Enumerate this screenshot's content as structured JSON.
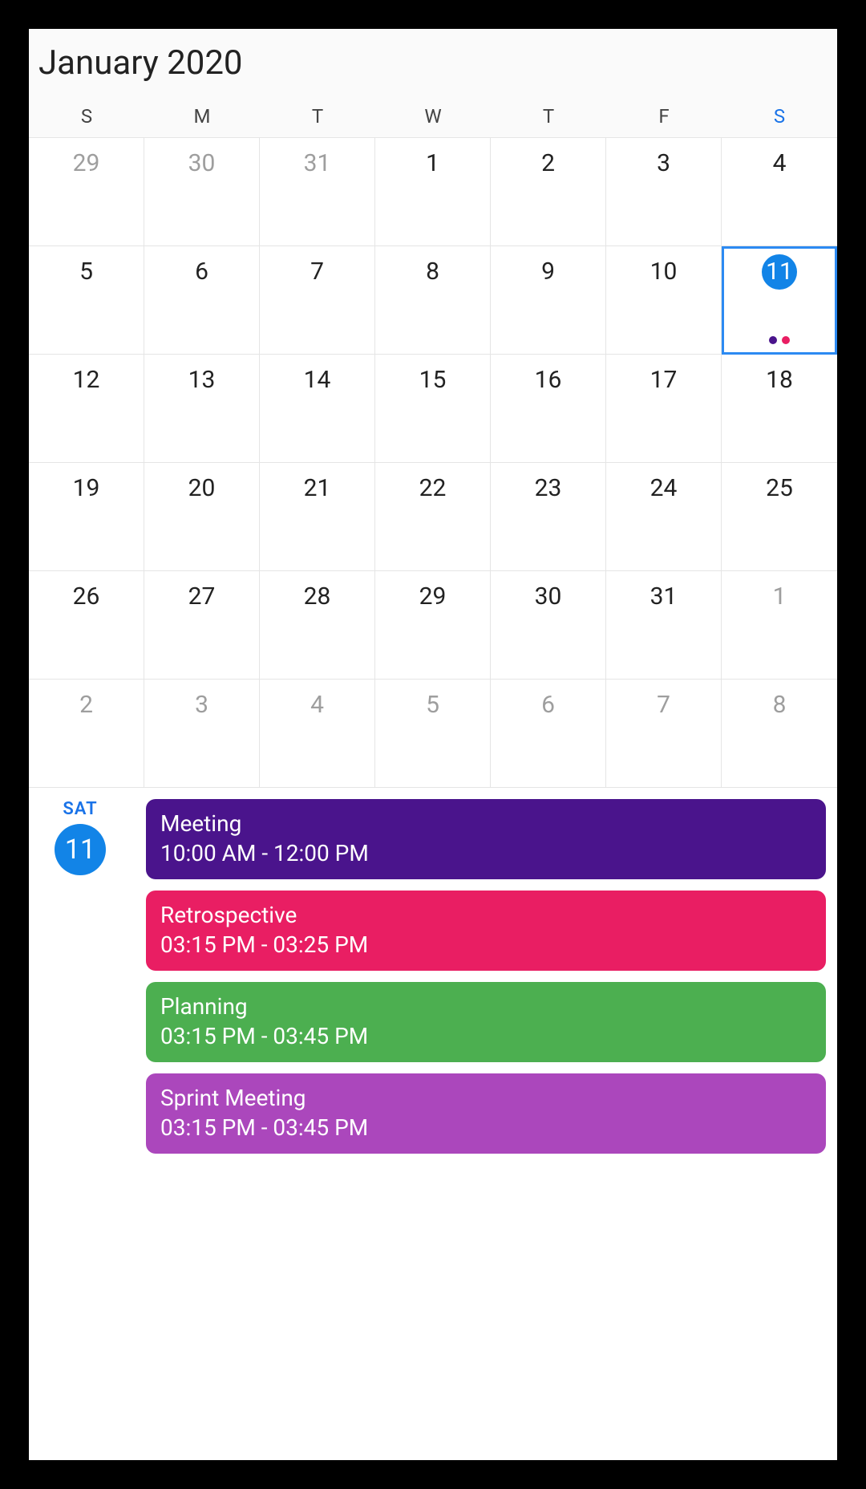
{
  "header": {
    "month_title": "January 2020"
  },
  "dow": [
    "S",
    "M",
    "T",
    "W",
    "T",
    "F",
    "S"
  ],
  "weeks": [
    [
      {
        "n": "29",
        "other": true
      },
      {
        "n": "30",
        "other": true
      },
      {
        "n": "31",
        "other": true
      },
      {
        "n": "1"
      },
      {
        "n": "2"
      },
      {
        "n": "3"
      },
      {
        "n": "4"
      }
    ],
    [
      {
        "n": "5"
      },
      {
        "n": "6"
      },
      {
        "n": "7"
      },
      {
        "n": "8"
      },
      {
        "n": "9"
      },
      {
        "n": "10"
      },
      {
        "n": "11",
        "selected": true,
        "dots": [
          "#4a148c",
          "#e91e63"
        ]
      }
    ],
    [
      {
        "n": "12"
      },
      {
        "n": "13"
      },
      {
        "n": "14"
      },
      {
        "n": "15"
      },
      {
        "n": "16"
      },
      {
        "n": "17"
      },
      {
        "n": "18"
      }
    ],
    [
      {
        "n": "19"
      },
      {
        "n": "20"
      },
      {
        "n": "21"
      },
      {
        "n": "22"
      },
      {
        "n": "23"
      },
      {
        "n": "24"
      },
      {
        "n": "25"
      }
    ],
    [
      {
        "n": "26"
      },
      {
        "n": "27"
      },
      {
        "n": "28"
      },
      {
        "n": "29"
      },
      {
        "n": "30"
      },
      {
        "n": "31"
      },
      {
        "n": "1",
        "other": true
      }
    ],
    [
      {
        "n": "2",
        "other": true
      },
      {
        "n": "3",
        "other": true
      },
      {
        "n": "4",
        "other": true
      },
      {
        "n": "5",
        "other": true
      },
      {
        "n": "6",
        "other": true
      },
      {
        "n": "7",
        "other": true
      },
      {
        "n": "8",
        "other": true
      }
    ]
  ],
  "agenda": {
    "dow": "SAT",
    "day": "11",
    "events": [
      {
        "title": "Meeting",
        "time": "10:00 AM - 12:00 PM",
        "color": "#4a148c"
      },
      {
        "title": "Retrospective",
        "time": "03:15 PM - 03:25 PM",
        "color": "#e91e63"
      },
      {
        "title": "Planning",
        "time": "03:15 PM - 03:45 PM",
        "color": "#4caf50"
      },
      {
        "title": "Sprint Meeting",
        "time": "03:15 PM - 03:45 PM",
        "color": "#ab47bc"
      }
    ]
  }
}
